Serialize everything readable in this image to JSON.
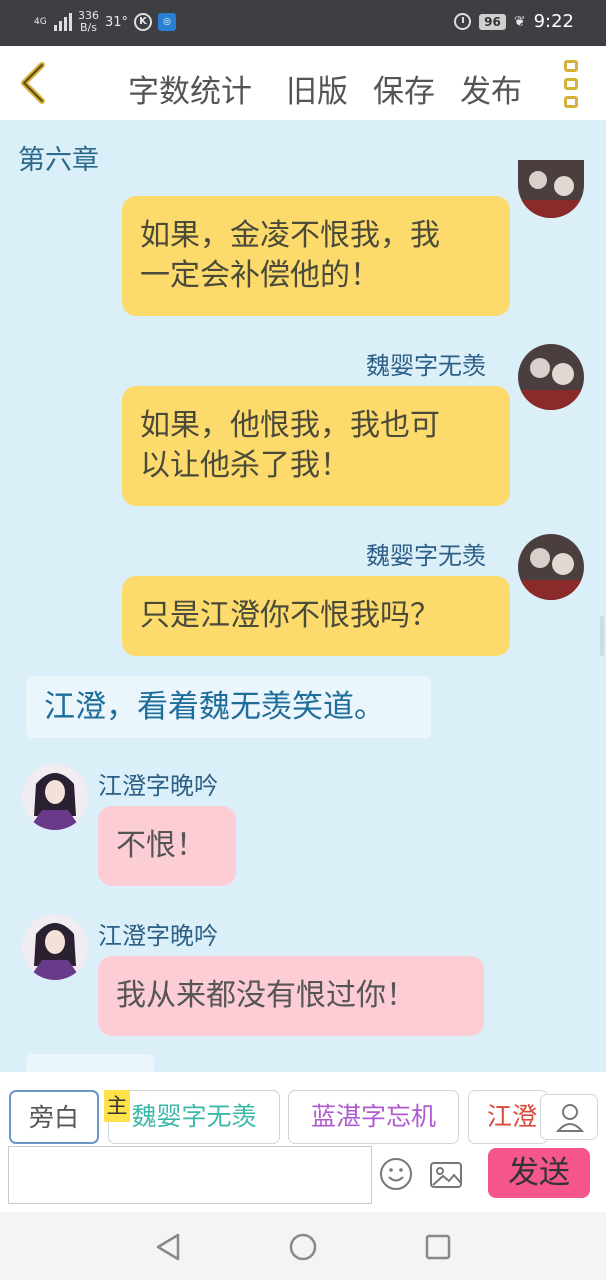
{
  "status_bar": {
    "network": "4G",
    "speed_value": "336",
    "speed_unit": "B/s",
    "temperature": "31°",
    "battery": "96",
    "time": "9:22"
  },
  "top_bar": {
    "word_count_label": "字数统计",
    "old_version_label": "旧版",
    "save_label": "保存",
    "publish_label": "发布"
  },
  "chat": {
    "chapter": "第六章",
    "messages": [
      {
        "text_line1": "如果，金凌不恨我，我",
        "text_line2": "一定会补偿他的！"
      },
      {
        "speaker": "魏婴字无羡",
        "text_line1": "如果，他恨我，我也可",
        "text_line2": "以让他杀了我！"
      },
      {
        "speaker": "魏婴字无羡",
        "text": "只是江澄你不恨我吗？"
      },
      {
        "narration": "江澄，看着魏无羡笑道。"
      },
      {
        "speaker": "江澄字晚吟",
        "text": "不恨！"
      },
      {
        "speaker": "江澄字晚吟",
        "text": "我从来都没有恨过你！"
      }
    ]
  },
  "characters": {
    "narrator": "旁白",
    "main_tag": "主",
    "items": [
      {
        "label": "魏婴字无羡",
        "color": "#3cb8a8"
      },
      {
        "label": "蓝湛字忘机",
        "color": "#b05ad0"
      },
      {
        "label": "江澄",
        "color": "#d84a3a"
      }
    ]
  },
  "input": {
    "value": "",
    "send_label": "发送"
  },
  "colors": {
    "chat_bg": "#dbeff9",
    "bubble_yellow": "#fcda6c",
    "bubble_pink": "#fdcdd6",
    "send_button": "#f5568d",
    "accent_gold": "#d4b23a"
  }
}
